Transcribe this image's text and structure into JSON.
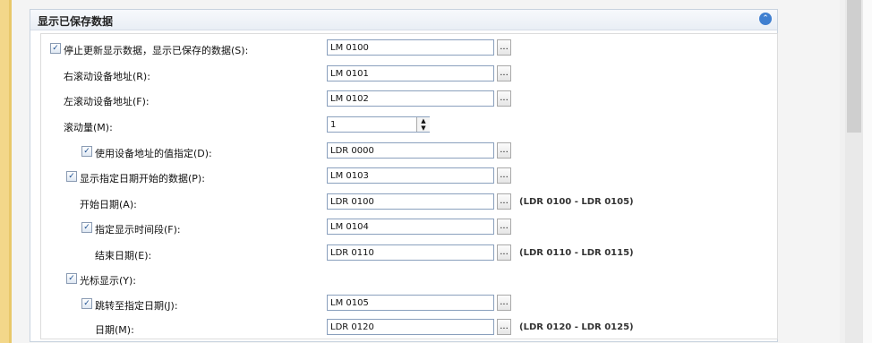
{
  "panel": {
    "title": "显示已保存数据"
  },
  "rows": {
    "stop_update": {
      "label": "停止更新显示数据，显示已保存的数据(S):",
      "value": "LM 0100",
      "checked": true
    },
    "right_scroll": {
      "label": "右滚动设备地址(R):",
      "value": "LM 0101"
    },
    "left_scroll": {
      "label": "左滚动设备地址(F):",
      "value": "LM 0102"
    },
    "scroll_amount": {
      "label": "滚动量(M):",
      "value": "1"
    },
    "use_device_value": {
      "label": "使用设备地址的值指定(D):",
      "value": "LDR 0000",
      "checked": true
    },
    "show_from_date": {
      "label": "显示指定日期开始的数据(P):",
      "value": "LM 0103",
      "checked": true
    },
    "start_date": {
      "label": "开始日期(A):",
      "value": "LDR 0100",
      "range": "(LDR 0100 - LDR 0105)"
    },
    "specify_period": {
      "label": "指定显示时间段(F):",
      "value": "LM 0104",
      "checked": true
    },
    "end_date": {
      "label": "结束日期(E):",
      "value": "LDR 0110",
      "range": "(LDR 0110 - LDR 0115)"
    },
    "cursor_display": {
      "label": "光标显示(Y):",
      "checked": true
    },
    "jump_to_date": {
      "label": "跳转至指定日期(J):",
      "value": "LM 0105",
      "checked": true
    },
    "date": {
      "label": "日期(M):",
      "value": "LDR 0120",
      "range": "(LDR 0120 - LDR 0125)"
    }
  },
  "icons": {
    "ellipsis": "...",
    "check": "✓",
    "collapse": "⌃"
  }
}
